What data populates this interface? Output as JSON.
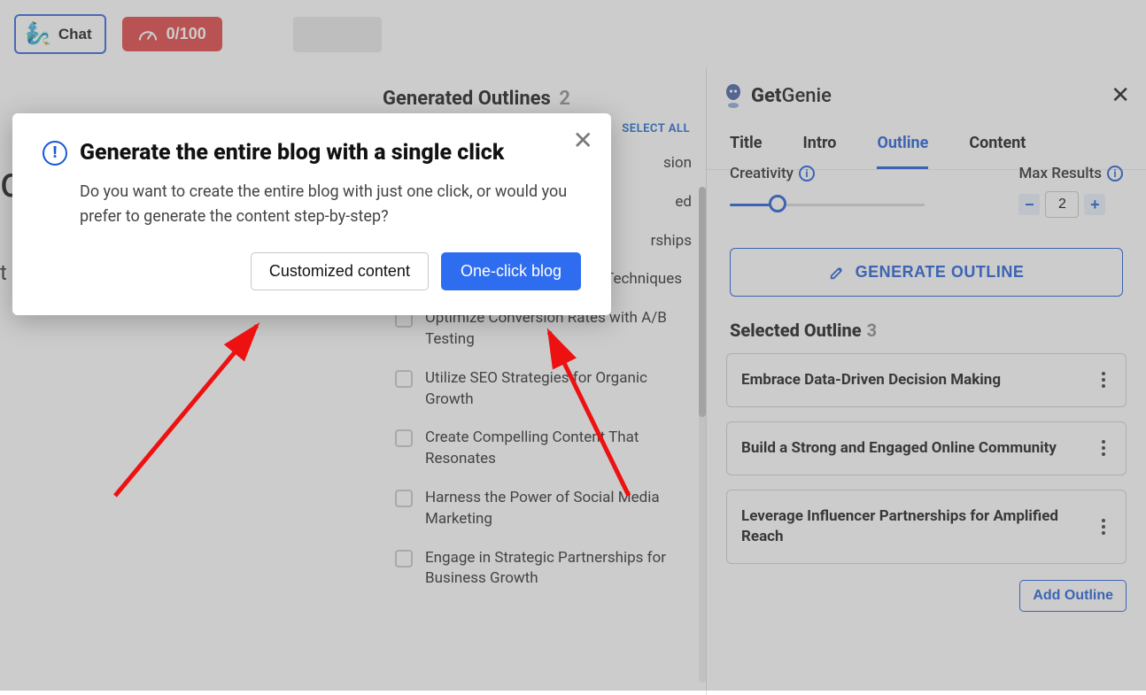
{
  "topbar": {
    "chat_label": "Chat",
    "usage_label": "0/100"
  },
  "middle": {
    "heading": "Generated Outlines",
    "count": "2",
    "select_all": "SELECT ALL",
    "items": [
      "sion",
      "ed",
      "rships",
      "Implement Viral Marketing Techniques",
      "Optimize Conversion Rates with A/B Testing",
      "Utilize SEO Strategies for Organic Growth",
      "Create Compelling Content That Resonates",
      "Harness the Power of Social Media Marketing",
      "Engage in Strategic Partnerships for Business Growth"
    ]
  },
  "right": {
    "brand_get": "Get",
    "brand_genie": "Genie",
    "tabs": {
      "title": "Title",
      "intro": "Intro",
      "outline": "Outline",
      "content": "Content"
    },
    "creativity_label": "Creativity",
    "max_results_label": "Max Results",
    "max_results_value": "2",
    "generate_btn": "GENERATE OUTLINE",
    "selected_heading": "Selected Outline",
    "selected_count": "3",
    "selected": [
      "Embrace Data-Driven Decision Making",
      "Build a Strong and Engaged Online Community",
      "Leverage Influencer Partnerships for Amplified Reach"
    ],
    "add_outline": "Add Outline"
  },
  "modal": {
    "title": "Generate the entire blog with a single click",
    "body": "Do you want to create the entire blog with just one click, or would you prefer to generate the content step-by-step?",
    "secondary": "Customized content",
    "primary": "One-click blog"
  }
}
